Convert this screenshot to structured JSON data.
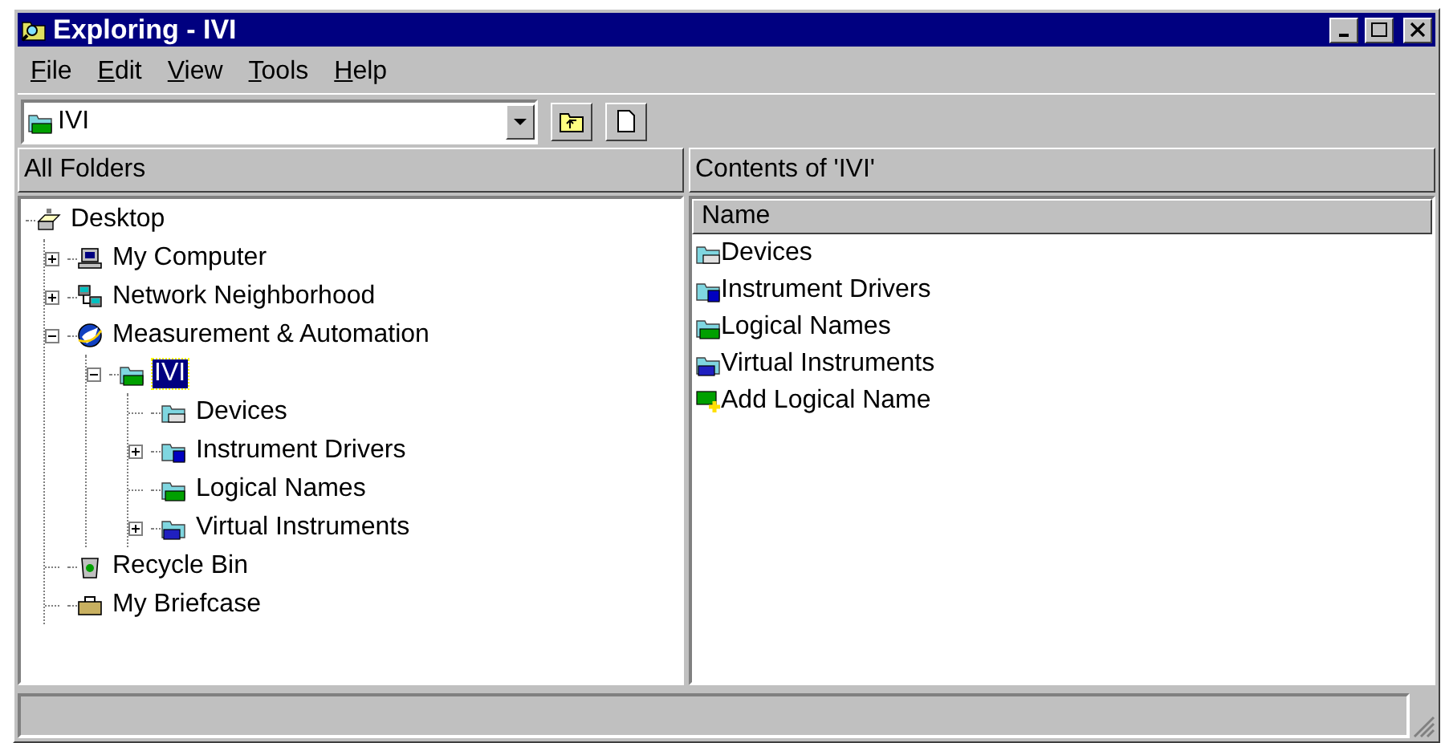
{
  "window": {
    "title": "Exploring - IVI"
  },
  "menu": [
    "File",
    "Edit",
    "View",
    "Tools",
    "Help"
  ],
  "address": {
    "value": "IVI",
    "kind": "ivi-folder"
  },
  "left_pane": {
    "title": "All Folders",
    "tree": [
      {
        "label": "Desktop",
        "kind": "desktop",
        "selected": false,
        "children": [
          {
            "label": "My Computer",
            "kind": "computer",
            "selected": false,
            "expanded": false
          },
          {
            "label": "Network Neighborhood",
            "kind": "network",
            "selected": false,
            "expanded": false
          },
          {
            "label": "Measurement & Automation",
            "kind": "globe",
            "selected": false,
            "expanded": true,
            "children": [
              {
                "label": "IVI",
                "kind": "ivi-folder",
                "selected": true,
                "expanded": true,
                "children": [
                  {
                    "label": "Devices",
                    "kind": "device-folder",
                    "selected": false
                  },
                  {
                    "label": "Instrument Drivers",
                    "kind": "driver-folder",
                    "selected": false,
                    "expanded": false
                  },
                  {
                    "label": "Logical Names",
                    "kind": "ivi-folder",
                    "selected": false
                  },
                  {
                    "label": "Virtual Instruments",
                    "kind": "vi-folder",
                    "selected": false,
                    "expanded": false
                  }
                ]
              }
            ]
          },
          {
            "label": "Recycle Bin",
            "kind": "recycle-bin",
            "selected": false
          },
          {
            "label": "My Briefcase",
            "kind": "briefcase",
            "selected": false
          }
        ]
      }
    ]
  },
  "right_pane": {
    "title": "Contents of 'IVI'",
    "columns": [
      "Name"
    ],
    "items": [
      {
        "label": "Devices",
        "kind": "device-folder"
      },
      {
        "label": "Instrument Drivers",
        "kind": "driver-folder"
      },
      {
        "label": "Logical Names",
        "kind": "ivi-folder"
      },
      {
        "label": "Virtual Instruments",
        "kind": "vi-folder"
      },
      {
        "label": "Add Logical Name",
        "kind": "add-ivi"
      }
    ]
  }
}
